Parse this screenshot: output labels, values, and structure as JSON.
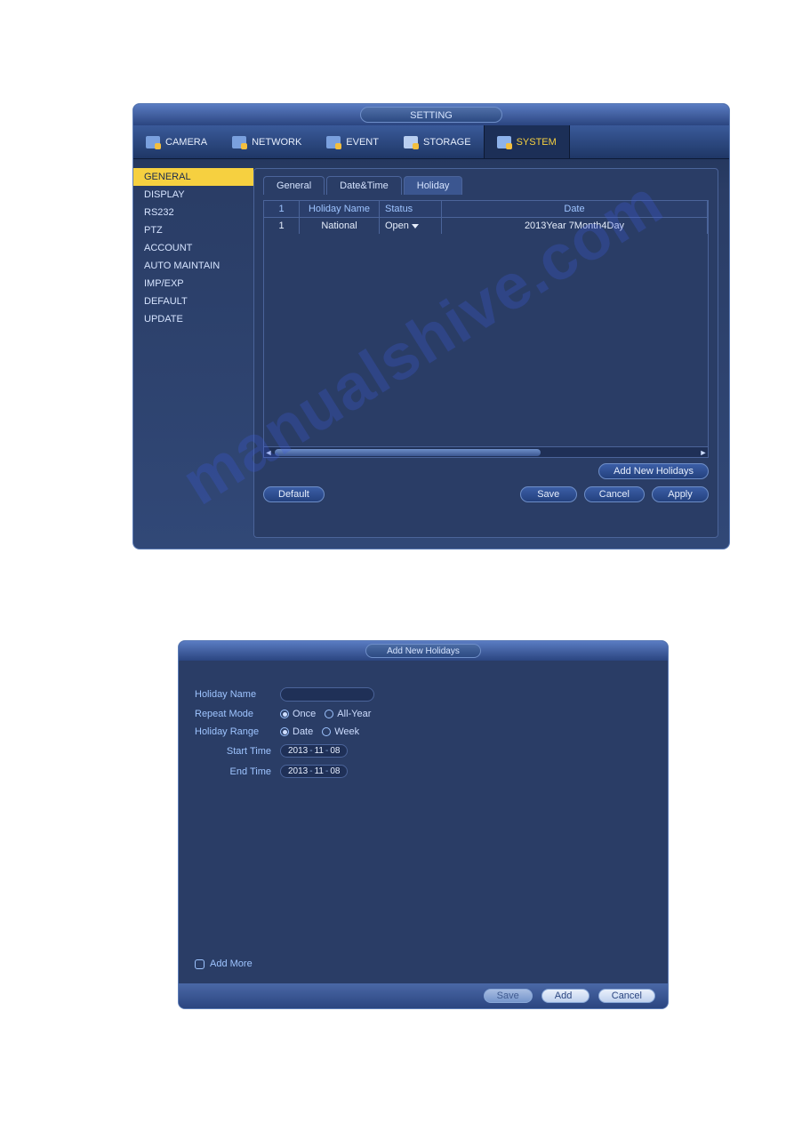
{
  "watermark": "manualshive.com",
  "panel1": {
    "title": "SETTING",
    "topnav": [
      {
        "label": "CAMERA",
        "name": "topnav-camera"
      },
      {
        "label": "NETWORK",
        "name": "topnav-network"
      },
      {
        "label": "EVENT",
        "name": "topnav-event"
      },
      {
        "label": "STORAGE",
        "name": "topnav-storage"
      },
      {
        "label": "SYSTEM",
        "name": "topnav-system",
        "active": true
      }
    ],
    "sidebar": [
      {
        "label": "GENERAL",
        "active": true
      },
      {
        "label": "DISPLAY"
      },
      {
        "label": "RS232"
      },
      {
        "label": "PTZ"
      },
      {
        "label": "ACCOUNT"
      },
      {
        "label": "AUTO MAINTAIN"
      },
      {
        "label": "IMP/EXP"
      },
      {
        "label": "DEFAULT"
      },
      {
        "label": "UPDATE"
      }
    ],
    "subtabs": [
      {
        "label": "General"
      },
      {
        "label": "Date&Time"
      },
      {
        "label": "Holiday",
        "active": true
      }
    ],
    "table": {
      "headers": {
        "idx": "1",
        "name": "Holiday Name",
        "status": "Status",
        "date": "Date"
      },
      "rows": [
        {
          "idx": "1",
          "name": "National",
          "status": "Open",
          "date": "2013Year 7Month4Day"
        }
      ]
    },
    "buttons": {
      "add_new": "Add New Holidays",
      "default": "Default",
      "save": "Save",
      "cancel": "Cancel",
      "apply": "Apply"
    }
  },
  "panel2": {
    "title": "Add New Holidays",
    "labels": {
      "holiday_name": "Holiday Name",
      "repeat_mode": "Repeat Mode",
      "holiday_range": "Holiday Range",
      "start_time": "Start Time",
      "end_time": "End Time",
      "add_more": "Add More"
    },
    "repeat_mode": {
      "once": "Once",
      "all_year": "All-Year",
      "selected": "once"
    },
    "holiday_range": {
      "date": "Date",
      "week": "Week",
      "selected": "date"
    },
    "start_time": {
      "y": "2013",
      "m": "11",
      "d": "08"
    },
    "end_time": {
      "y": "2013",
      "m": "11",
      "d": "08"
    },
    "footer": {
      "save": "Save",
      "add": "Add",
      "cancel": "Cancel"
    }
  }
}
